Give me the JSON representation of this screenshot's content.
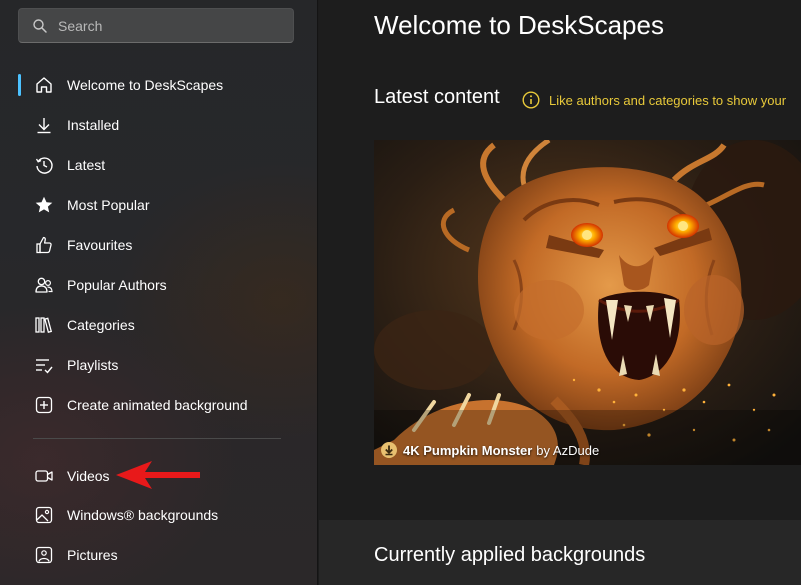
{
  "search": {
    "placeholder": "Search"
  },
  "sidebar": {
    "items": [
      {
        "label": "Welcome to DeskScapes",
        "icon": "home-icon"
      },
      {
        "label": "Installed",
        "icon": "download-icon"
      },
      {
        "label": "Latest",
        "icon": "history-icon"
      },
      {
        "label": "Most Popular",
        "icon": "star-icon"
      },
      {
        "label": "Favourites",
        "icon": "thumbs-up-icon"
      },
      {
        "label": "Popular Authors",
        "icon": "people-icon"
      },
      {
        "label": "Categories",
        "icon": "library-icon"
      },
      {
        "label": "Playlists",
        "icon": "playlist-icon"
      },
      {
        "label": "Create animated background",
        "icon": "add-icon"
      }
    ],
    "secondary": [
      {
        "label": "Videos",
        "icon": "video-icon"
      },
      {
        "label": "Windows® backgrounds",
        "icon": "image-icon"
      },
      {
        "label": "Pictures",
        "icon": "picture-icon"
      }
    ]
  },
  "main": {
    "title": "Welcome to DeskScapes",
    "latest": {
      "title": "Latest content",
      "info": "Like authors and categories to show your"
    },
    "featured": {
      "name": "4K Pumpkin Monster",
      "by": "by AzDude"
    },
    "applied": {
      "title": "Currently applied backgrounds"
    }
  },
  "colors": {
    "accent": "#4cc2ff",
    "info": "#e8c93a",
    "annotation_arrow": "#e8191a"
  }
}
